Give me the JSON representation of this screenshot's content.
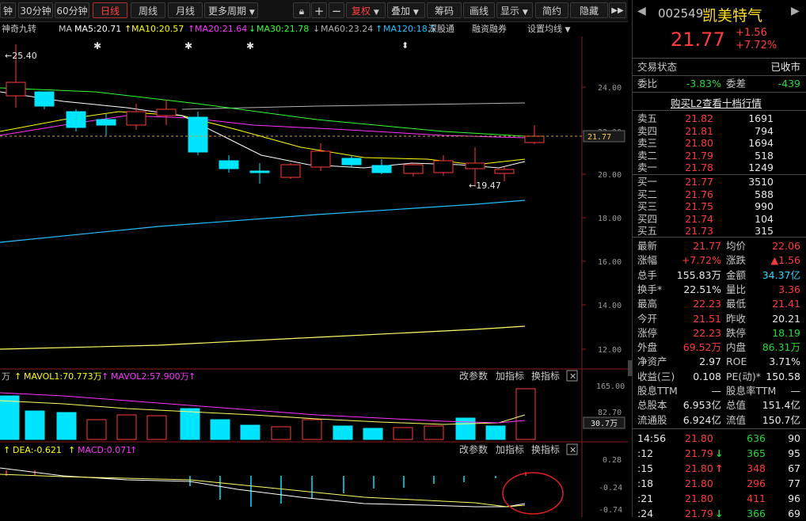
{
  "toolbar": {
    "buttons": [
      "钟",
      "30分钟",
      "60分钟",
      "日线",
      "周线",
      "月线",
      "更多周期",
      "复权",
      "叠加",
      "筹码",
      "画线",
      "显示",
      "简约",
      "隐藏"
    ],
    "icons": [
      "lock-icon",
      "plus-icon",
      "minus-icon",
      "dropdown-icon",
      "double-chevron-right-icon"
    ],
    "active": "日线"
  },
  "ma_line": {
    "name": "神奇九转",
    "ma_label": "MA",
    "ma5": "MA5:20.71",
    "ma10": "MA10:20.57",
    "ma20": "MA20:21.64",
    "ma30": "MA30:21.78",
    "ma60": "MA60:23.24",
    "ma120": "MA120:18.5",
    "shenzhen": "深股通",
    "margin": "融资融券",
    "settings": "设置均线"
  },
  "price_chart": {
    "y_ticks": [
      "24.00",
      "22.00",
      "20.00",
      "18.00",
      "16.00",
      "14.00",
      "12.00"
    ],
    "high_label": "←25.40",
    "low_label": "←19.47",
    "current": "21.77"
  },
  "volume": {
    "unit": "万",
    "mavol1": "MAVOL1:70.773万",
    "mavol2": "MAVOL2:57.900万",
    "params": "改参数",
    "add": "加指标",
    "switch": "换指标",
    "ticks": [
      "165.00",
      "82.70"
    ],
    "current": "30.7万"
  },
  "macd": {
    "dea": "DEA:-0.621",
    "macd": "MACD:0.071",
    "params": "改参数",
    "add": "加指标",
    "switch": "换指标",
    "ticks": [
      "0.28",
      "-0.24",
      "-0.74"
    ]
  },
  "stock": {
    "code": "002549",
    "name": "凯美特气",
    "price": "21.77",
    "change": "+1.56",
    "pct": "+7.72%",
    "status_label": "交易状态",
    "status": "已收市",
    "weibi_label": "委比",
    "weibi": "-3.83%",
    "weicha_label": "委差",
    "weicha": "-439",
    "l2": "购买L2查看十档行情"
  },
  "asks": [
    {
      "label": "卖五",
      "price": "21.82",
      "vol": "1691"
    },
    {
      "label": "卖四",
      "price": "21.81",
      "vol": "794"
    },
    {
      "label": "卖三",
      "price": "21.80",
      "vol": "1694"
    },
    {
      "label": "卖二",
      "price": "21.79",
      "vol": "518"
    },
    {
      "label": "卖一",
      "price": "21.78",
      "vol": "1249"
    }
  ],
  "bids": [
    {
      "label": "买一",
      "price": "21.77",
      "vol": "3510"
    },
    {
      "label": "买二",
      "price": "21.76",
      "vol": "588"
    },
    {
      "label": "买三",
      "price": "21.75",
      "vol": "990"
    },
    {
      "label": "买四",
      "price": "21.74",
      "vol": "104"
    },
    {
      "label": "买五",
      "price": "21.73",
      "vol": "315"
    }
  ],
  "stats": [
    {
      "l1": "最新",
      "v1": "21.77",
      "c1": "red",
      "l2": "均价",
      "v2": "22.06",
      "c2": "red"
    },
    {
      "l1": "涨幅",
      "v1": "+7.72%",
      "c1": "red",
      "l2": "涨跌",
      "v2": "▲1.56",
      "c2": "red"
    },
    {
      "l1": "总手",
      "v1": "155.83万",
      "c1": "white",
      "l2": "金额",
      "v2": "34.37亿",
      "c2": "cyan"
    },
    {
      "l1": "换手*",
      "v1": "22.51%",
      "c1": "white",
      "l2": "量比",
      "v2": "3.36",
      "c2": "red"
    },
    {
      "l1": "最高",
      "v1": "22.23",
      "c1": "red",
      "l2": "最低",
      "v2": "21.41",
      "c2": "red"
    },
    {
      "l1": "今开",
      "v1": "21.51",
      "c1": "red",
      "l2": "昨收",
      "v2": "20.21",
      "c2": "white"
    },
    {
      "l1": "涨停",
      "v1": "22.23",
      "c1": "red",
      "l2": "跌停",
      "v2": "18.19",
      "c2": "green"
    },
    {
      "l1": "外盘",
      "v1": "69.52万",
      "c1": "red",
      "l2": "内盘",
      "v2": "86.31万",
      "c2": "green"
    },
    {
      "l1": "净资产",
      "v1": "2.97",
      "c1": "white",
      "l2": "ROE",
      "v2": "3.71%",
      "c2": "white"
    },
    {
      "l1": "收益(三)",
      "v1": "0.108",
      "c1": "white",
      "l2": "PE(动)*",
      "v2": "150.58",
      "c2": "white"
    },
    {
      "l1": "股息TTM",
      "v1": "—",
      "c1": "white",
      "l2": "股息率TTM",
      "v2": "—",
      "c2": "white"
    },
    {
      "l1": "总股本",
      "v1": "6.953亿",
      "c1": "white",
      "l2": "总值",
      "v2": "151.4亿",
      "c2": "white"
    },
    {
      "l1": "流通股",
      "v1": "6.924亿",
      "c1": "white",
      "l2": "流值",
      "v2": "150.7亿",
      "c2": "white"
    }
  ],
  "ticks": [
    {
      "time": "14:56",
      "price": "21.80",
      "arrow": "",
      "vol": "636",
      "num": "90",
      "vc": "green"
    },
    {
      "time": ":12",
      "price": "21.79",
      "arrow": "↓",
      "vol": "365",
      "num": "95",
      "vc": "green"
    },
    {
      "time": ":15",
      "price": "21.80",
      "arrow": "↑",
      "vol": "348",
      "num": "67",
      "vc": "red"
    },
    {
      "time": ":18",
      "price": "21.80",
      "arrow": "",
      "vol": "296",
      "num": "77",
      "vc": "red"
    },
    {
      "time": ":21",
      "price": "21.80",
      "arrow": "",
      "vol": "411",
      "num": "96",
      "vc": "red"
    },
    {
      "time": ":24",
      "price": "21.79",
      "arrow": "↓",
      "vol": "366",
      "num": "69",
      "vc": "green"
    }
  ],
  "colors": {
    "up": "#ff3b3b",
    "down": "#00e5ff",
    "ma5": "#ffffff",
    "ma10": "#ffff00",
    "ma20": "#ff33ff",
    "ma30": "#33ff33",
    "ma60": "#b0b0b0",
    "ma120": "#22c0ff"
  }
}
